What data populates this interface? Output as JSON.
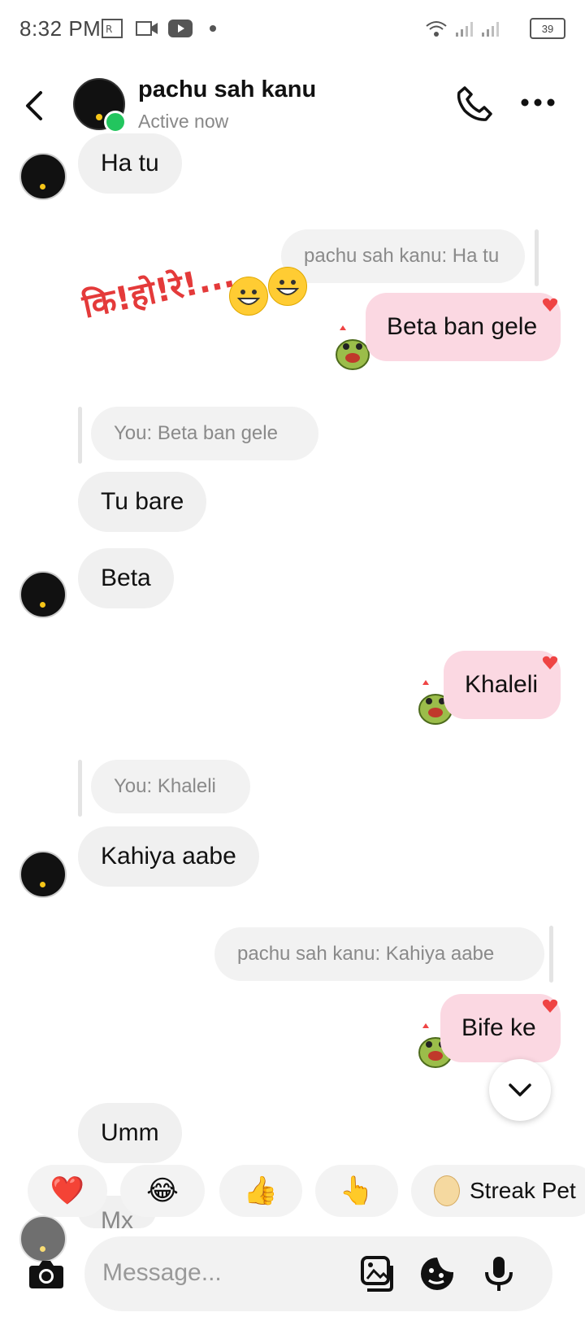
{
  "status_bar": {
    "time": "8:32 PM",
    "battery": "39"
  },
  "header": {
    "name": "pachu sah kanu",
    "status": "Active now"
  },
  "messages": {
    "m1": "Ha tu",
    "q1": "pachu sah kanu: Ha tu",
    "m2": "Beta ban gele",
    "overlay_text": "कि!हो!रे!...",
    "q2": "You: Beta ban gele",
    "m3": "Tu bare",
    "m4": "Beta",
    "m5": "Khaleli",
    "q3": "You: Khaleli",
    "m6": "Kahiya aabe",
    "q4": "pachu sah kanu: Kahiya aabe",
    "m7": "Bife ke",
    "m8": "Umm",
    "m9_partial": "Mx"
  },
  "quick_reactions": {
    "r1": "❤️",
    "r2": "😂",
    "r3": "👍",
    "r4": "👆",
    "streak_label": "Streak Pet"
  },
  "composer": {
    "placeholder": "Message..."
  },
  "colors": {
    "outgoing_bubble": "#fbd8e2",
    "incoming_bubble": "#f0f0f0",
    "online": "#22c55e",
    "heart": "#ef4444"
  },
  "icons": [
    "back-arrow-icon",
    "phone-icon",
    "more-icon",
    "camera-icon",
    "gallery-icon",
    "sticker-icon",
    "mic-icon",
    "chevron-down-icon",
    "heart-icon"
  ]
}
